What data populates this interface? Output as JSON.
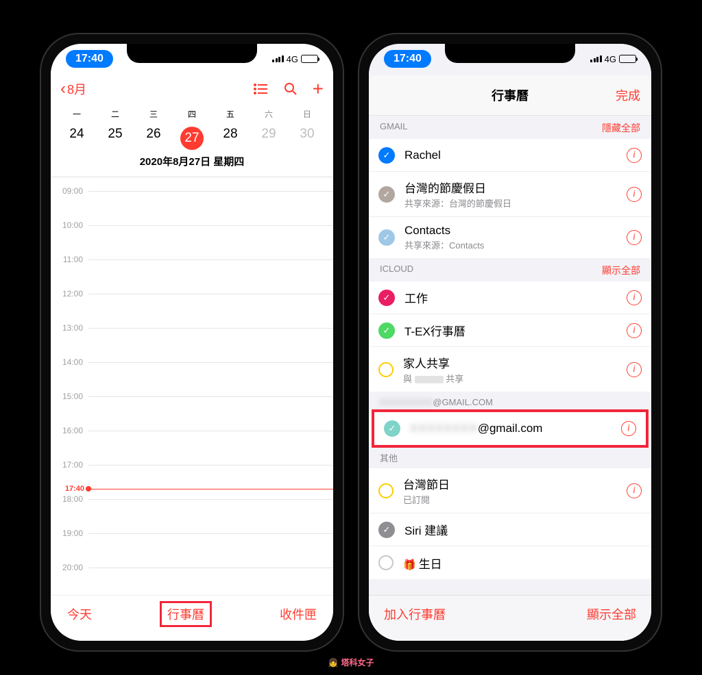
{
  "status": {
    "time": "17:40",
    "network": "4G"
  },
  "left": {
    "back_label": "8月",
    "week_labels": [
      "一",
      "二",
      "三",
      "四",
      "五",
      "六",
      "日"
    ],
    "days": [
      "24",
      "25",
      "26",
      "27",
      "28",
      "29",
      "30"
    ],
    "selected_index": 3,
    "date_title": "2020年8月27日 星期四",
    "hours": [
      "09:00",
      "10:00",
      "11:00",
      "12:00",
      "13:00",
      "14:00",
      "15:00",
      "16:00",
      "17:00",
      "18:00",
      "19:00",
      "20:00"
    ],
    "now_label": "17:40",
    "bottom": {
      "today": "今天",
      "calendars": "行事曆",
      "inbox": "收件匣"
    }
  },
  "right": {
    "title": "行事曆",
    "done": "完成",
    "sections": [
      {
        "header": "GMAIL",
        "action": "隱藏全部",
        "items": [
          {
            "color": "#007aff",
            "checked": true,
            "title": "Rachel",
            "sub": ""
          },
          {
            "color": "#b2a7a0",
            "checked": true,
            "title": "台灣的節慶假日",
            "sub": "共享來源：台灣的節慶假日"
          },
          {
            "color": "#9fc8e6",
            "checked": true,
            "title": "Contacts",
            "sub": "共享來源：Contacts"
          }
        ]
      },
      {
        "header": "ICLOUD",
        "action": "顯示全部",
        "items": [
          {
            "color": "#e91e63",
            "checked": true,
            "title": "工作",
            "sub": ""
          },
          {
            "color": "#4cd964",
            "checked": true,
            "title": "T-EX行事曆",
            "sub": ""
          },
          {
            "color": "#ffcc00",
            "checked": false,
            "ring": true,
            "title": "家人共享",
            "sub": "與           共享",
            "subblur": true
          }
        ]
      },
      {
        "header_blur": true,
        "header": "@GMAIL.COM",
        "action": "",
        "highlight_row": true,
        "items": [
          {
            "color": "#7fd3c9",
            "checked": true,
            "title_suffix": "@gmail.com",
            "title_blur": true,
            "sub": ""
          }
        ]
      },
      {
        "header": "其他",
        "action": "",
        "items": [
          {
            "color": "#ffcc00",
            "checked": false,
            "ring": true,
            "title": "台灣節日",
            "sub": "已訂閱"
          },
          {
            "color": "#8e8e93",
            "checked": true,
            "title": "Siri 建議",
            "sub": "",
            "noinfo": true
          },
          {
            "color": "#c7c7cc",
            "checked": false,
            "ring": true,
            "title": "生日",
            "sub": "",
            "gift": true,
            "noinfo": true
          }
        ]
      }
    ],
    "bottom": {
      "add": "加入行事曆",
      "show_all": "顯示全部"
    }
  },
  "watermark": "塔科女子"
}
